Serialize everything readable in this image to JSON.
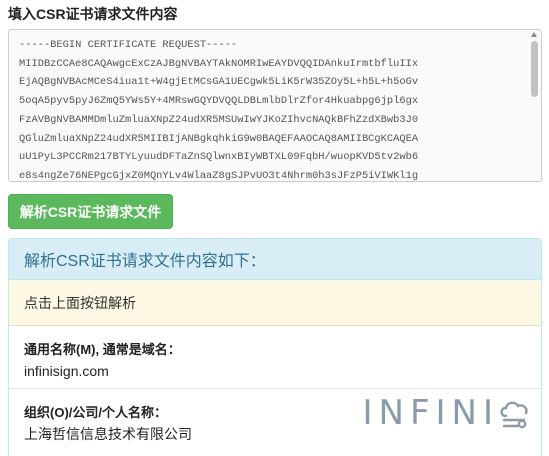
{
  "csr_section": {
    "label": "填入CSR证书请求文件内容",
    "csr_text": "-----BEGIN CERTIFICATE REQUEST-----\nMIIDBzCCAe8CAQAwgcExCzAJBgNVBAYTAkNOMRIwEAYDVQQIDAnkuIrmtbfluIIx\nEjAQBgNVBAcMCeS4iua1t+W4gjEtMCsGA1UECgwk5LiK5rW35ZOy5L+h5L+h5oGv\n5oqA5pyv5pyJ6ZmQ5YWs5Y+4MRswGQYDVQQLDBLmlbDlrZfor4Hkuabpg6jpl6gx\nFzAVBgNVBAMMDmluZmluaXNpZ24udXR5MSUwIwYJKoZIhvcNAQkBFhZzdXBwb3J0\nQGluZmluaXNpZ24udXR5MIIBIjANBgkqhkiG9w0BAQEFAAOCAQ8AMIIBCgKCAQEA\nuU1PyL3PCCRm217BTYLyuudDFTaZnSQlwnxBIyWBTXL09FqbH/wuopKVD5tv2wb6\ne8s4ngZe76NEPgcGjxZ0MQnYLv4WlaaZ8gSJPvUO3t4Nhrm0h3sJFzP5iVIWKl1g"
  },
  "parse_button": {
    "label": "解析CSR证书请求文件"
  },
  "result": {
    "heading": "解析CSR证书请求文件内容如下：",
    "notice": "点击上面按钮解析",
    "fields": {
      "common_name": {
        "label": "通用名称(M), 通常是域名：",
        "value": "infinisign.com"
      },
      "organization": {
        "label": "组织(O)/公司/个人名称：",
        "value": "上海哲信信息技术有限公司"
      }
    }
  },
  "brand": {
    "text": "INFINI",
    "icon": "cloud-key-icon",
    "color": "#8a9aa9"
  }
}
